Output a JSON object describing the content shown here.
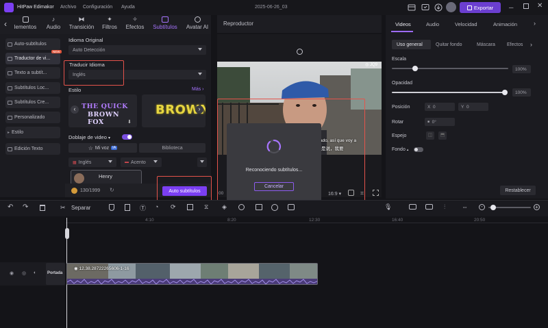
{
  "titlebar": {
    "app_name": "HitPaw Edimakor",
    "menus": [
      "Archivo",
      "Configuración",
      "Ayuda"
    ],
    "project": "2025-06-26_03",
    "export_label": "Exportar"
  },
  "media_tabs": [
    {
      "label": "lementos",
      "icon": "elements-icon"
    },
    {
      "label": "Audio",
      "icon": "music-icon"
    },
    {
      "label": "Transición",
      "icon": "transition-icon"
    },
    {
      "label": "Filtros",
      "icon": "filter-icon"
    },
    {
      "label": "Efectos",
      "icon": "effects-icon"
    },
    {
      "label": "Subtítulos",
      "icon": "subtitles-icon",
      "active": true
    },
    {
      "label": "Avatar AI",
      "icon": "avatar-icon"
    }
  ],
  "sidebar": {
    "items": [
      {
        "label": "Auto-subtítulos"
      },
      {
        "label": "Traductor de vi...",
        "active": true,
        "badge": "NEW"
      },
      {
        "label": "Texto a subtít..."
      },
      {
        "label": "Subtítulos Loc..."
      },
      {
        "label": "Subtítulos Cre..."
      },
      {
        "label": "Personalizado"
      },
      {
        "label": "Estilo"
      },
      {
        "label": "Edición Texto"
      }
    ]
  },
  "panel": {
    "original_lang_label": "Idioma Original",
    "original_lang_value": "Auto Detección",
    "translate_label": "Traducir Idioma",
    "translate_value": "Inglés",
    "style_label": "Estilo",
    "more_label": "Más",
    "tpl1_line1": "THE QUICK",
    "tpl1_line2": "BROWN FOX",
    "tpl2_text": "BROWN",
    "dub_label": "Doblaje de video",
    "my_voice_tab": "Mi voz",
    "ia_badge": "IA",
    "library_tab": "Biblioteca",
    "lang_select": "Inglés",
    "accent_select": "Acento",
    "voice_name": "Henry",
    "credits": "130/1999",
    "auto_subtitles_btn": "Auto subtítulos"
  },
  "player": {
    "title": "Reproductor",
    "video_caption_line1": "ado, así que voy a",
    "video_caption_line2": "是说，我要",
    "time_left": "00",
    "ratio": "16:9",
    "modal_text": "Reconociendo subtítulos...",
    "cancel_label": "Cancelar"
  },
  "right": {
    "tabs": [
      "Videos",
      "Audio",
      "Velocidad",
      "Animación"
    ],
    "subtabs": [
      "Uso general",
      "Quitar fondo",
      "Máscara",
      "Efectos"
    ],
    "scale_label": "Escala",
    "scale_value": "100%",
    "opacity_label": "Opacidad",
    "opacity_value": "100%",
    "position_label": "Posición",
    "pos_x_label": "X",
    "pos_x_value": "0",
    "pos_y_label": "Y",
    "pos_y_value": "0",
    "rotate_label": "Rotar",
    "rotate_value": "0°",
    "mirror_label": "Espejo",
    "background_label": "Fondo",
    "reset_label": "Restablecer"
  },
  "timeline": {
    "split_label": "Separar",
    "ticks": [
      "4:10",
      "8:20",
      "12:30",
      "16:40",
      "20:50"
    ],
    "clip_name": "12.38.28722265606-1-16",
    "cover_label": "Portada"
  },
  "colors": {
    "accent": "#7b3ff2",
    "highlight_box": "#e5534b"
  }
}
